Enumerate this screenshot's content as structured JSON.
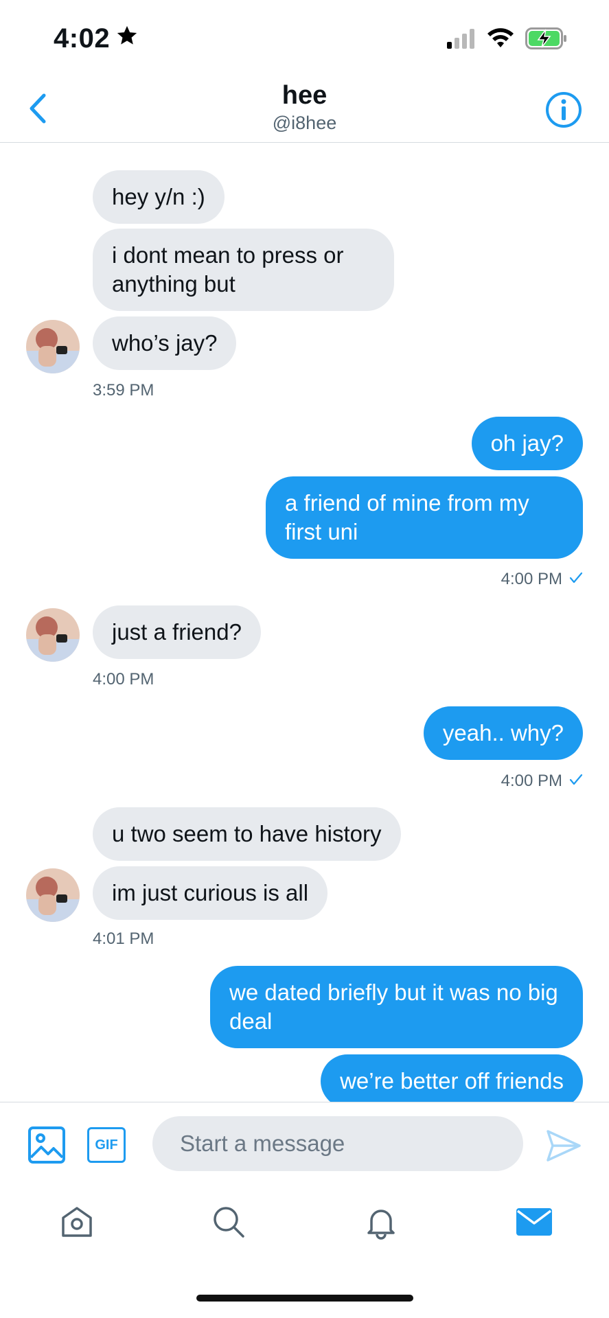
{
  "status_bar": {
    "time": "4:02"
  },
  "header": {
    "name": "hee",
    "handle": "@i8hee"
  },
  "messages": [
    {
      "text": "hey y/n :)"
    },
    {
      "text": "i dont mean to press or anything but"
    },
    {
      "text": "who’s jay?"
    },
    {
      "text": "oh jay?"
    },
    {
      "text": "a friend of mine from my first uni"
    },
    {
      "text": "just a friend?"
    },
    {
      "text": "yeah.. why?"
    },
    {
      "text": "u two seem to have history"
    },
    {
      "text": "im just curious is all"
    },
    {
      "text": "we dated briefly but it was no big deal"
    },
    {
      "text": "we’re better off friends"
    }
  ],
  "timestamps": [
    "3:59 PM",
    "4:00 PM",
    "4:00 PM",
    "4:00 PM",
    "4:01 PM"
  ],
  "composer": {
    "placeholder": "Start a message",
    "gif_label": "GIF"
  },
  "tabs": [
    "home-icon",
    "search-icon",
    "bell-icon",
    "mail-icon"
  ],
  "colors": {
    "accent": "#1d9bf0",
    "incoming_bubble": "#e7eaee",
    "battery": "#4cd964"
  }
}
